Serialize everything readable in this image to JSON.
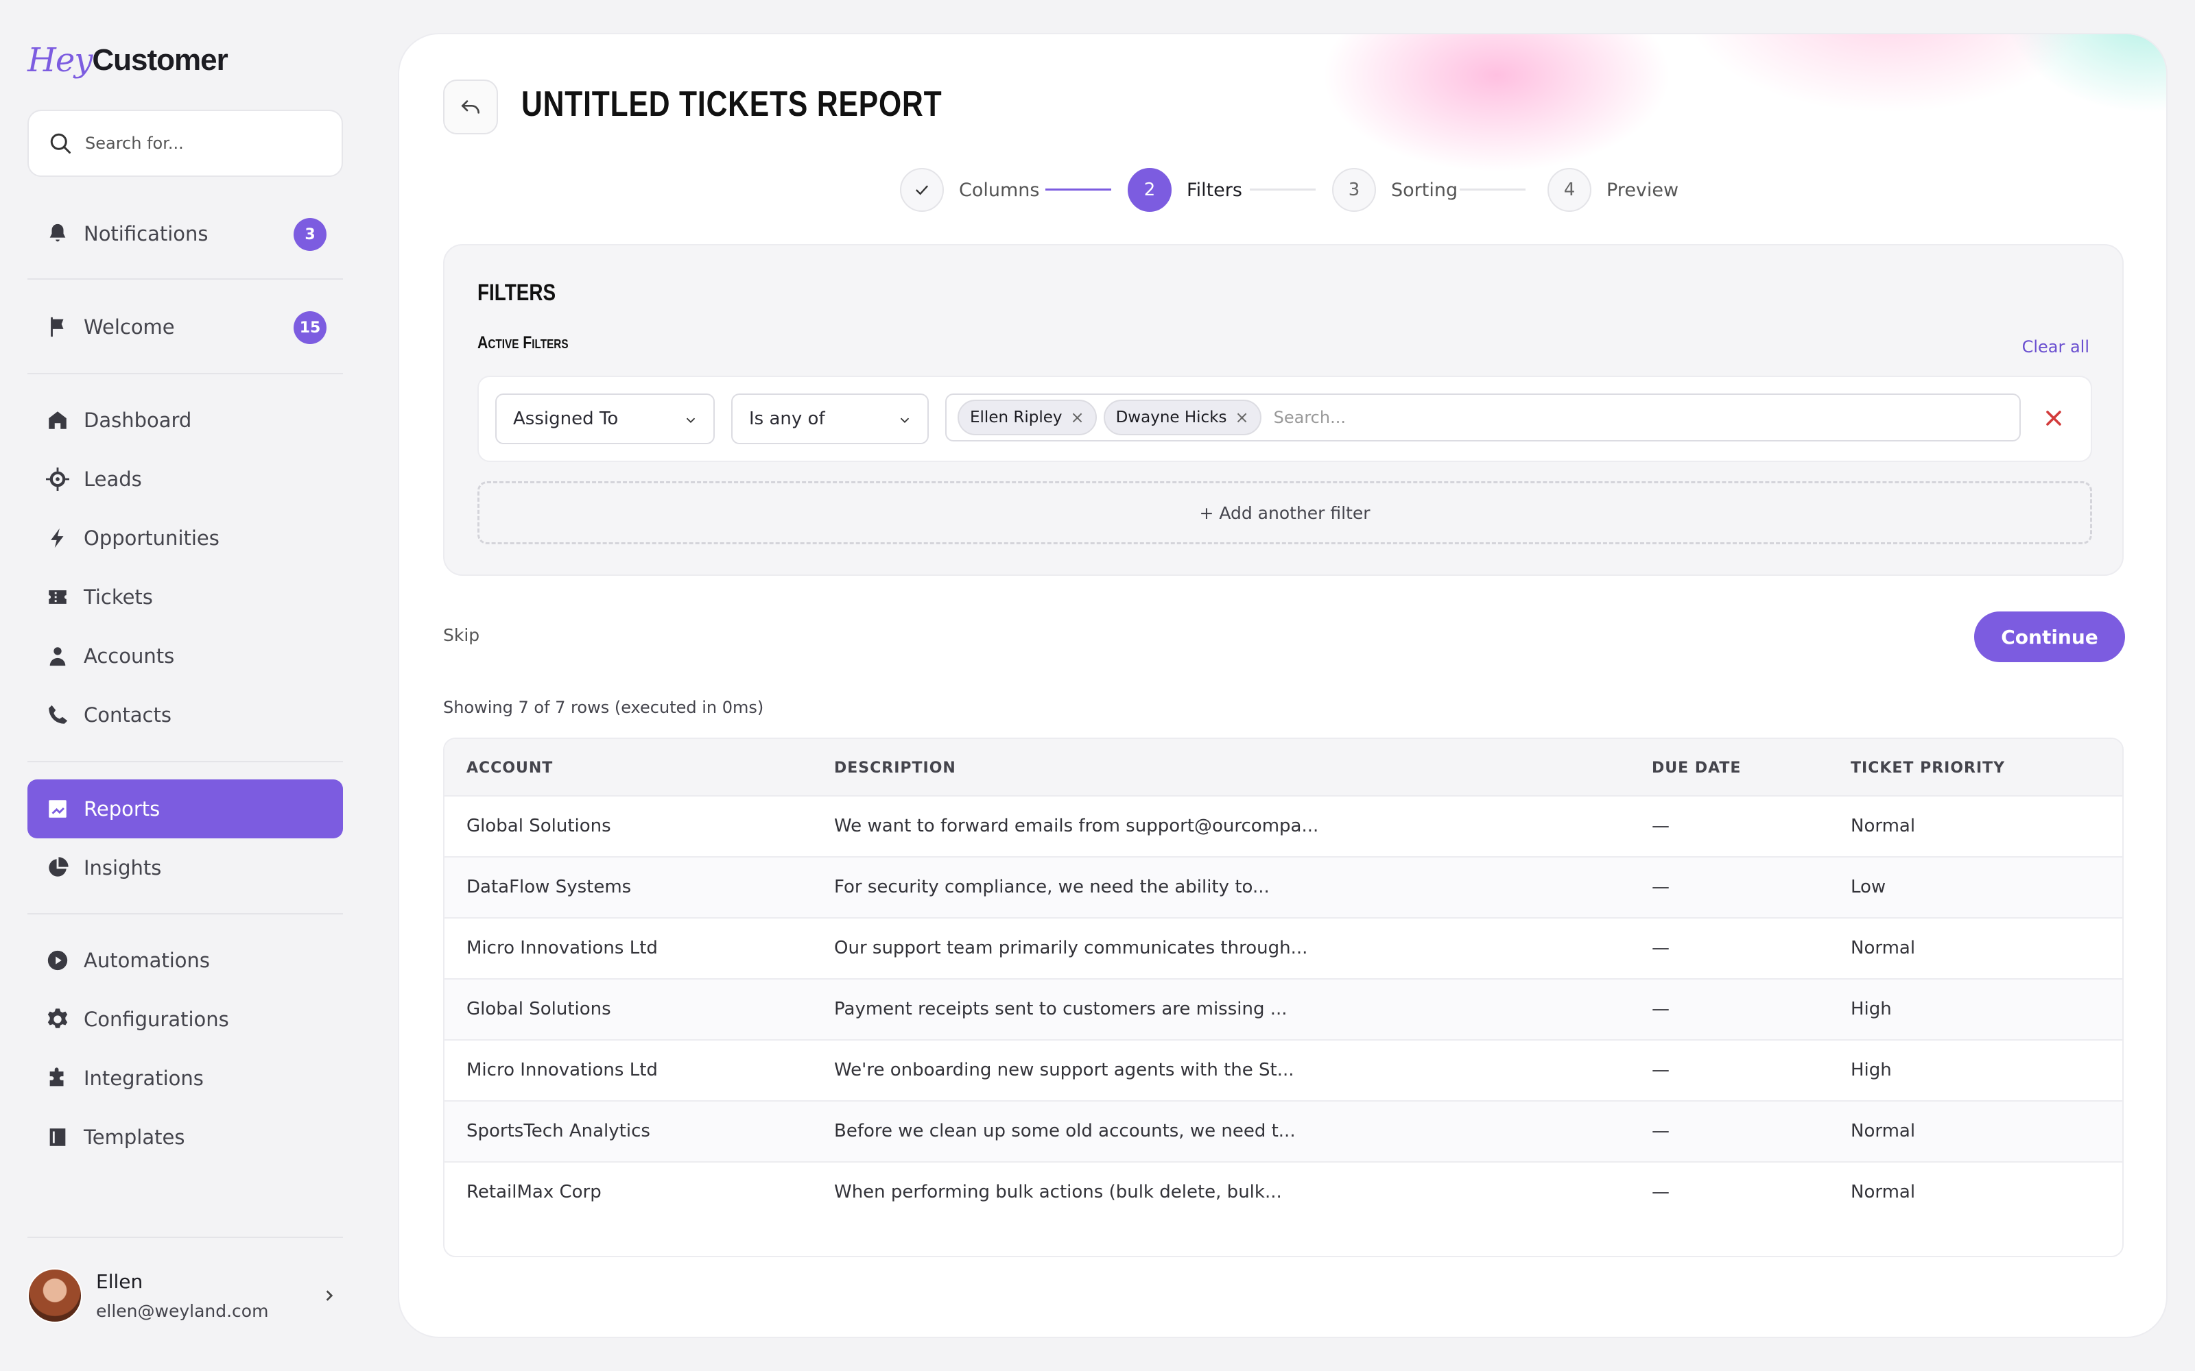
{
  "app": {
    "logo_hey": "Hey",
    "logo_customer": "Customer"
  },
  "sidebar": {
    "search_placeholder": "Search for...",
    "notifications": {
      "label": "Notifications",
      "badge": "3"
    },
    "welcome": {
      "label": "Welcome",
      "badge": "15"
    },
    "items": [
      {
        "label": "Dashboard",
        "icon": "home-icon"
      },
      {
        "label": "Leads",
        "icon": "target-icon"
      },
      {
        "label": "Opportunities",
        "icon": "bolt-icon"
      },
      {
        "label": "Tickets",
        "icon": "ticket-icon"
      },
      {
        "label": "Accounts",
        "icon": "user-icon"
      },
      {
        "label": "Contacts",
        "icon": "phone-icon"
      },
      {
        "label": "Reports",
        "icon": "chart-icon",
        "active": true
      },
      {
        "label": "Insights",
        "icon": "pie-icon"
      },
      {
        "label": "Automations",
        "icon": "play-icon"
      },
      {
        "label": "Configurations",
        "icon": "gear-icon"
      },
      {
        "label": "Integrations",
        "icon": "puzzle-icon"
      },
      {
        "label": "Templates",
        "icon": "template-icon"
      }
    ],
    "user": {
      "name": "Ellen",
      "email": "ellen@weyland.com"
    }
  },
  "header": {
    "title": "UNTITLED TICKETS REPORT"
  },
  "stepper": [
    {
      "number": "1",
      "label": "Columns",
      "state": "done"
    },
    {
      "number": "2",
      "label": "Filters",
      "state": "current"
    },
    {
      "number": "3",
      "label": "Sorting",
      "state": "pending"
    },
    {
      "number": "4",
      "label": "Preview",
      "state": "pending"
    }
  ],
  "filters": {
    "title": "FILTERS",
    "active_title": "Active Filters",
    "clear_all": "Clear all",
    "field": "Assigned To",
    "operator": "Is any of",
    "chips": [
      "Ellen Ripley",
      "Dwayne Hicks"
    ],
    "search_placeholder": "Search...",
    "add_filter": "+ Add another filter"
  },
  "actions": {
    "skip": "Skip",
    "continue": "Continue"
  },
  "results": {
    "info": "Showing 7 of 7 rows (executed in 0ms)",
    "columns": [
      "ACCOUNT",
      "DESCRIPTION",
      "DUE DATE",
      "TICKET PRIORITY"
    ],
    "rows": [
      [
        "Global Solutions",
        "We want to forward emails from support@ourcompa...",
        "—",
        "Normal"
      ],
      [
        "DataFlow Systems",
        "For security compliance, we need the ability to...",
        "—",
        "Low"
      ],
      [
        "Micro Innovations Ltd",
        "Our support team primarily communicates through...",
        "—",
        "Normal"
      ],
      [
        "Global Solutions",
        "Payment receipts sent to customers are missing ...",
        "—",
        "High"
      ],
      [
        "Micro Innovations Ltd",
        "We're onboarding new support agents with the St...",
        "—",
        "High"
      ],
      [
        "SportsTech Analytics",
        "Before we clean up some old accounts, we need t...",
        "—",
        "Normal"
      ],
      [
        "RetailMax Corp",
        "When performing bulk actions (bulk delete, bulk...",
        "—",
        "Normal"
      ]
    ]
  },
  "colors": {
    "accent": "#7c5ce0",
    "danger": "#d23a3a"
  }
}
